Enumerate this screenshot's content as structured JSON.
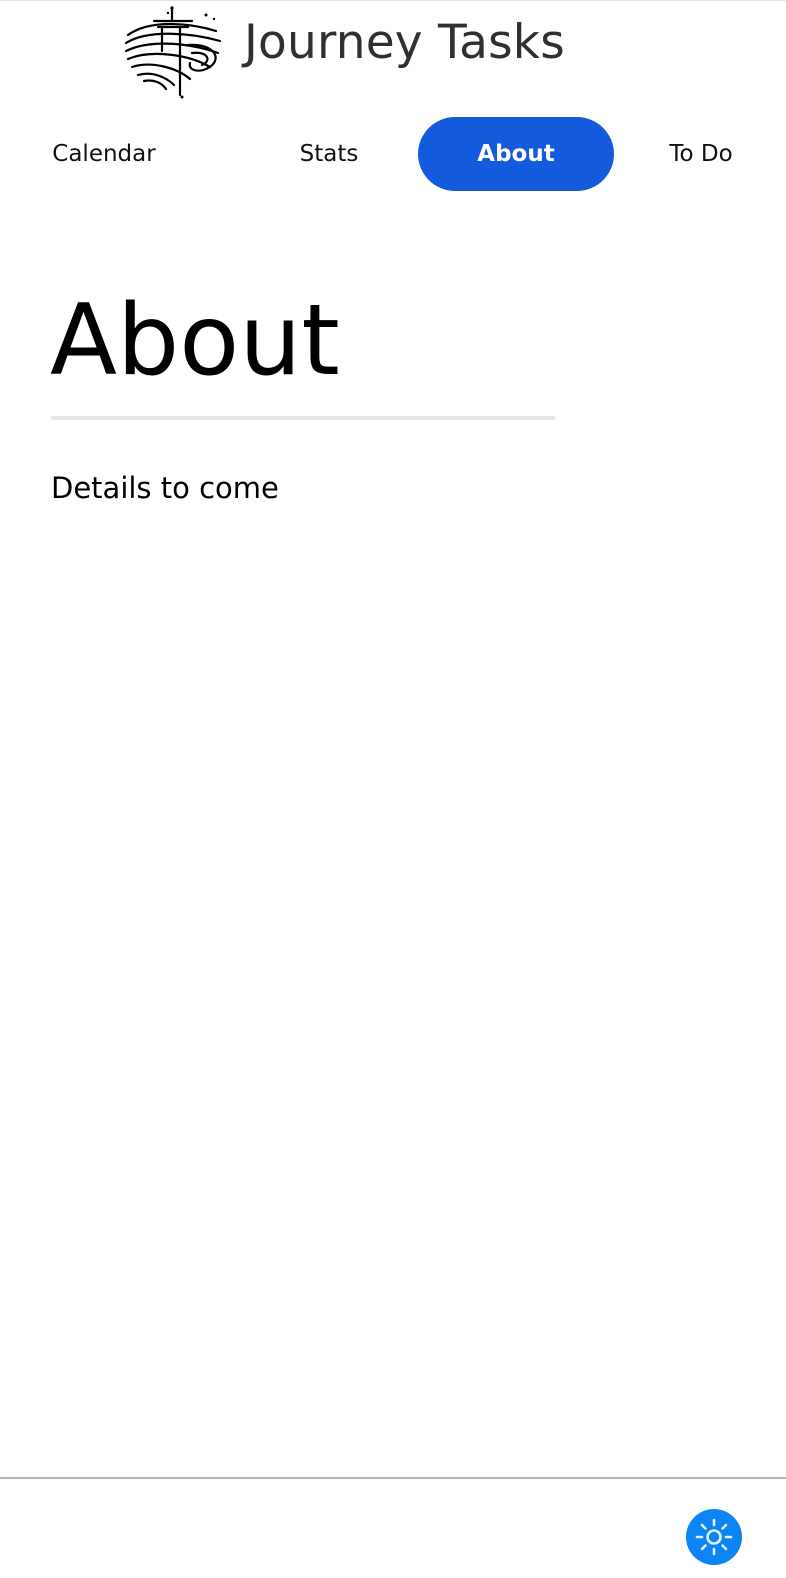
{
  "app": {
    "title": "Journey Tasks",
    "logo_icon": "journey-tasks-logo-icon"
  },
  "nav": {
    "items": [
      {
        "label": "Calendar",
        "active": false
      },
      {
        "label": "Stats",
        "active": false
      },
      {
        "label": "About",
        "active": true
      },
      {
        "label": "To Do",
        "active": false
      }
    ],
    "active_color": "#135adc"
  },
  "main": {
    "heading": "About",
    "body": "Details to come"
  },
  "footer": {
    "theme_toggle_icon": "sun-icon",
    "theme_toggle_color": "#0d84f3"
  }
}
